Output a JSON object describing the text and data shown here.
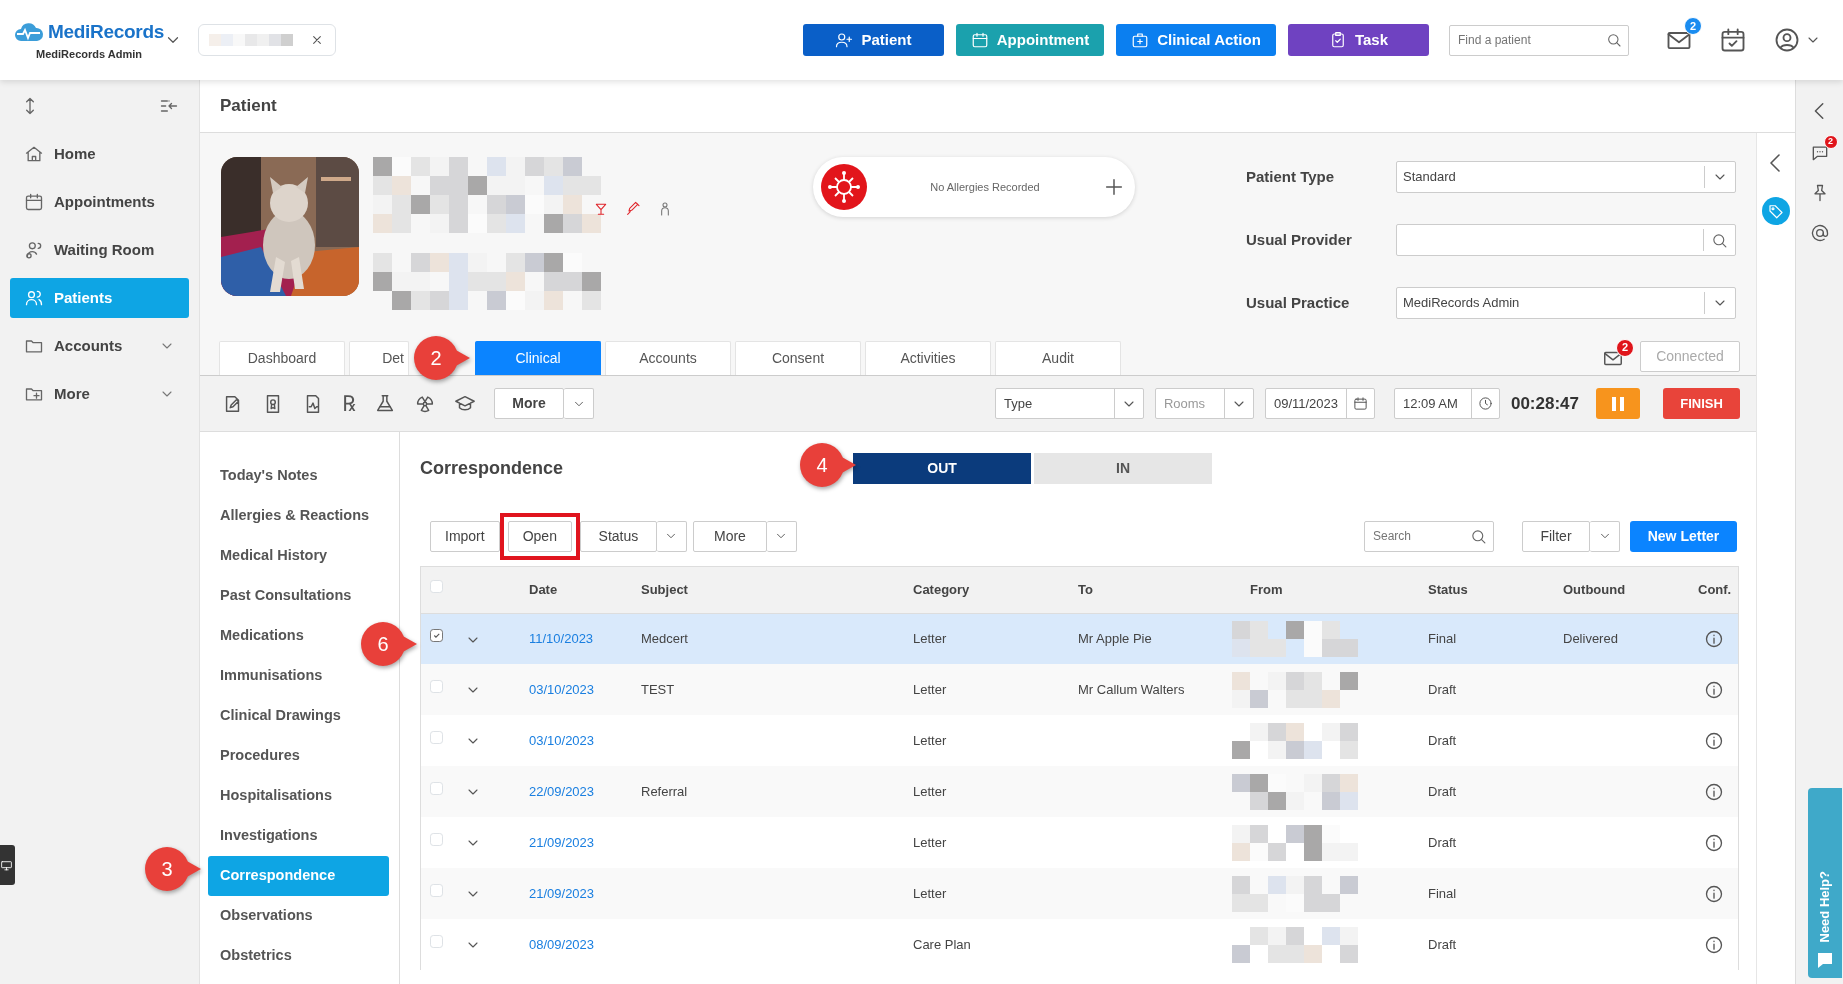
{
  "topbar": {
    "logo": "MediRecords",
    "organization": "MediRecords Admin",
    "quick_actions": [
      {
        "label": "Patient",
        "kind": "patient",
        "color": "#0a5fc8"
      },
      {
        "label": "Appointment",
        "kind": "appointment",
        "color": "#1ba1ad"
      },
      {
        "label": "Clinical Action",
        "kind": "clinical",
        "color": "#0b7ff0"
      },
      {
        "label": "Task",
        "kind": "task",
        "color": "#6f42c1"
      }
    ],
    "search_placeholder": "Find a patient",
    "mail_badge": "2"
  },
  "sidebar": {
    "items": [
      {
        "label": "Home",
        "kind": "home",
        "selected": false,
        "expandable": false
      },
      {
        "label": "Appointments",
        "kind": "calendar",
        "selected": false,
        "expandable": false
      },
      {
        "label": "Waiting Room",
        "kind": "waiting",
        "selected": false,
        "expandable": false
      },
      {
        "label": "Patients",
        "kind": "patients",
        "selected": true,
        "expandable": false
      },
      {
        "label": "Accounts",
        "kind": "folder",
        "selected": false,
        "expandable": true
      },
      {
        "label": "More",
        "kind": "folder-plus",
        "selected": false,
        "expandable": true
      }
    ]
  },
  "page_title": "Patient",
  "patient": {
    "allergy_status": "No Allergies Recorded",
    "fields": [
      {
        "label": "Patient Type",
        "value": "Standard",
        "kind": "select"
      },
      {
        "label": "Usual Provider",
        "kind": "search"
      },
      {
        "label": "Usual Practice",
        "value": "MediRecords Admin",
        "kind": "select"
      }
    ],
    "tabs": [
      {
        "label": "Dashboard",
        "selected": false
      },
      {
        "label": "Det",
        "selected": false
      },
      {
        "label": "Clinical",
        "selected": true
      },
      {
        "label": "Accounts",
        "selected": false
      },
      {
        "label": "Consent",
        "selected": false
      },
      {
        "label": "Activities",
        "selected": false
      },
      {
        "label": "Audit",
        "selected": false
      }
    ],
    "message_badge": "2",
    "connection": {
      "label": "Connected",
      "disabled": true
    }
  },
  "clinical_toolbar": {
    "rx_symbol": "℞",
    "more": "More",
    "type_value": "Type",
    "rooms_placeholder": "Rooms",
    "date": "09/11/2023",
    "time": "12:09 AM",
    "timer": "00:28:47",
    "finish": "FINISH"
  },
  "clinical_menu": [
    {
      "label": "Today's Notes",
      "selected": false
    },
    {
      "label": "Allergies & Reactions",
      "selected": false
    },
    {
      "label": "Medical History",
      "selected": false
    },
    {
      "label": "Past Consultations",
      "selected": false
    },
    {
      "label": "Medications",
      "selected": false
    },
    {
      "label": "Immunisations",
      "selected": false
    },
    {
      "label": "Clinical Drawings",
      "selected": false
    },
    {
      "label": "Procedures",
      "selected": false
    },
    {
      "label": "Hospitalisations",
      "selected": false
    },
    {
      "label": "Investigations",
      "selected": false
    },
    {
      "label": "Correspondence",
      "selected": true
    },
    {
      "label": "Observations",
      "selected": false
    },
    {
      "label": "Obstetrics",
      "selected": false
    }
  ],
  "correspondence": {
    "title": "Correspondence",
    "direction": [
      {
        "label": "OUT",
        "selected": true
      },
      {
        "label": "IN",
        "selected": false
      }
    ],
    "actions": [
      {
        "label": "Import",
        "kind": "button",
        "highlighted": false
      },
      {
        "label": "Open",
        "kind": "button",
        "highlighted": true
      },
      {
        "label": "Status",
        "kind": "split",
        "highlighted": false
      },
      {
        "label": "More",
        "kind": "split",
        "highlighted": false
      }
    ],
    "search_placeholder": "Search",
    "filter": "Filter",
    "new_letter": "New Letter",
    "table": {
      "all_selected": false,
      "columns": [
        "Date",
        "Subject",
        "Category",
        "To",
        "From",
        "Status",
        "Outbound",
        "Conf."
      ],
      "rows": [
        {
          "checked": true,
          "selected": true,
          "date": "11/10/2023",
          "subject": "Medcert",
          "category": "Letter",
          "to": "Mr Apple Pie",
          "status": "Final",
          "outbound": "Delivered"
        },
        {
          "checked": false,
          "selected": false,
          "date": "03/10/2023",
          "subject": "TEST",
          "category": "Letter",
          "to": "Mr Callum Walters",
          "status": "Draft"
        },
        {
          "checked": false,
          "selected": false,
          "date": "03/10/2023",
          "category": "Letter",
          "status": "Draft"
        },
        {
          "checked": false,
          "selected": false,
          "date": "22/09/2023",
          "subject": "Referral",
          "category": "Letter",
          "status": "Draft"
        },
        {
          "checked": false,
          "selected": false,
          "date": "21/09/2023",
          "category": "Letter",
          "status": "Draft"
        },
        {
          "checked": false,
          "selected": false,
          "date": "21/09/2023",
          "category": "Letter",
          "status": "Final"
        },
        {
          "checked": false,
          "selected": false,
          "date": "08/09/2023",
          "category": "Care Plan",
          "status": "Draft"
        }
      ]
    }
  },
  "right_panel": {
    "chat_badge": "2",
    "help": "Need Help?"
  },
  "annotations": [
    {
      "label": "2"
    },
    {
      "label": "3"
    },
    {
      "label": "4"
    },
    {
      "label": "6"
    }
  ]
}
